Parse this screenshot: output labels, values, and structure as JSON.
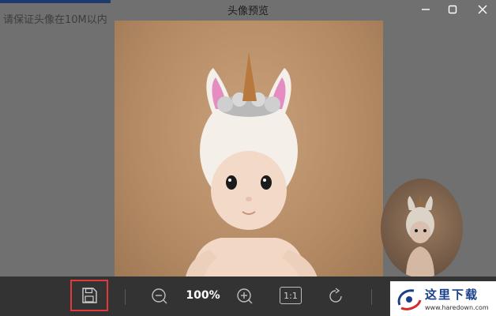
{
  "background": {
    "hint_text": "请保证头像在10M以内"
  },
  "window": {
    "title": "头像预览",
    "minimize_icon": "minimize-icon",
    "maximize_icon": "maximize-icon",
    "close_icon": "close-icon"
  },
  "preview": {
    "photo_subject": "toy-doll-photo"
  },
  "toolbar": {
    "zoom_level": "100%",
    "actual_size_label": "1:1",
    "save_icon": "save-icon",
    "zoom_out_icon": "zoom-out-icon",
    "zoom_in_icon": "zoom-in-icon",
    "rotate_icon": "rotate-icon",
    "highlight_color": "#e03a3a"
  },
  "watermark": {
    "text": "这里下载",
    "url": "www.haredown.com"
  }
}
